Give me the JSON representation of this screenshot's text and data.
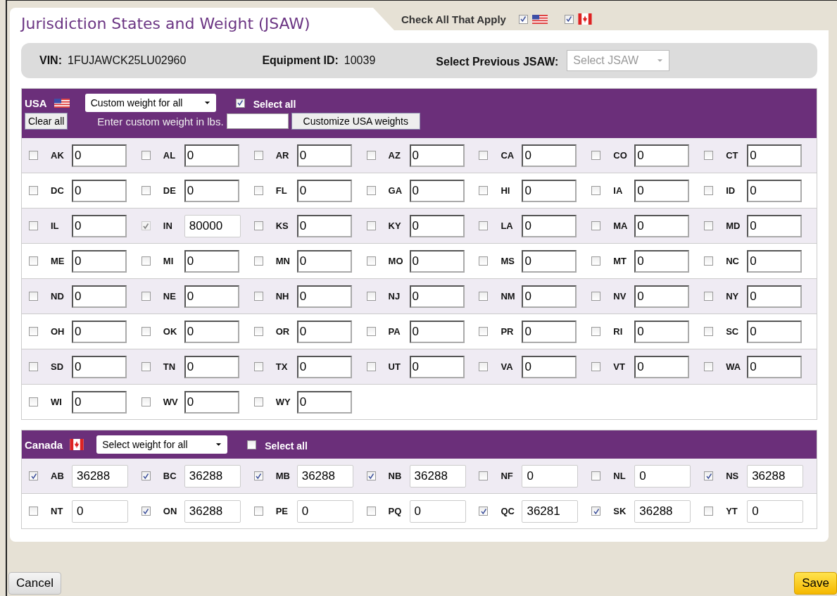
{
  "title": "Jurisdiction States and Weight (JSAW)",
  "apply": {
    "label": "Check All That Apply",
    "usa_checked": true,
    "canada_checked": true
  },
  "info": {
    "vin_label": "VIN:",
    "vin": "1FUJAWCK25LU02960",
    "equipment_label": "Equipment ID:",
    "equipment": "10039",
    "previous_label": "Select Previous JSAW:",
    "previous_placeholder": "Select JSAW"
  },
  "usa": {
    "name": "USA",
    "weight_select": "Custom weight for all",
    "select_all_label": "Select all",
    "select_all_checked": true,
    "clear_button": "Clear all",
    "custom_label": "Enter custom weight in lbs.",
    "customize_button": "Customize USA weights",
    "states": [
      {
        "code": "AK",
        "value": "0",
        "checked": false,
        "disabled": false
      },
      {
        "code": "AL",
        "value": "0",
        "checked": false,
        "disabled": false
      },
      {
        "code": "AR",
        "value": "0",
        "checked": false,
        "disabled": false
      },
      {
        "code": "AZ",
        "value": "0",
        "checked": false,
        "disabled": false
      },
      {
        "code": "CA",
        "value": "0",
        "checked": false,
        "disabled": false
      },
      {
        "code": "CO",
        "value": "0",
        "checked": false,
        "disabled": false
      },
      {
        "code": "CT",
        "value": "0",
        "checked": false,
        "disabled": false
      },
      {
        "code": "DC",
        "value": "0",
        "checked": false,
        "disabled": false
      },
      {
        "code": "DE",
        "value": "0",
        "checked": false,
        "disabled": false
      },
      {
        "code": "FL",
        "value": "0",
        "checked": false,
        "disabled": false
      },
      {
        "code": "GA",
        "value": "0",
        "checked": false,
        "disabled": false
      },
      {
        "code": "HI",
        "value": "0",
        "checked": false,
        "disabled": false
      },
      {
        "code": "IA",
        "value": "0",
        "checked": false,
        "disabled": false
      },
      {
        "code": "ID",
        "value": "0",
        "checked": false,
        "disabled": false
      },
      {
        "code": "IL",
        "value": "0",
        "checked": false,
        "disabled": false
      },
      {
        "code": "IN",
        "value": "80000",
        "checked": true,
        "disabled": true
      },
      {
        "code": "KS",
        "value": "0",
        "checked": false,
        "disabled": false
      },
      {
        "code": "KY",
        "value": "0",
        "checked": false,
        "disabled": false
      },
      {
        "code": "LA",
        "value": "0",
        "checked": false,
        "disabled": false
      },
      {
        "code": "MA",
        "value": "0",
        "checked": false,
        "disabled": false
      },
      {
        "code": "MD",
        "value": "0",
        "checked": false,
        "disabled": false
      },
      {
        "code": "ME",
        "value": "0",
        "checked": false,
        "disabled": false
      },
      {
        "code": "MI",
        "value": "0",
        "checked": false,
        "disabled": false
      },
      {
        "code": "MN",
        "value": "0",
        "checked": false,
        "disabled": false
      },
      {
        "code": "MO",
        "value": "0",
        "checked": false,
        "disabled": false
      },
      {
        "code": "MS",
        "value": "0",
        "checked": false,
        "disabled": false
      },
      {
        "code": "MT",
        "value": "0",
        "checked": false,
        "disabled": false
      },
      {
        "code": "NC",
        "value": "0",
        "checked": false,
        "disabled": false
      },
      {
        "code": "ND",
        "value": "0",
        "checked": false,
        "disabled": false
      },
      {
        "code": "NE",
        "value": "0",
        "checked": false,
        "disabled": false
      },
      {
        "code": "NH",
        "value": "0",
        "checked": false,
        "disabled": false
      },
      {
        "code": "NJ",
        "value": "0",
        "checked": false,
        "disabled": false
      },
      {
        "code": "NM",
        "value": "0",
        "checked": false,
        "disabled": false
      },
      {
        "code": "NV",
        "value": "0",
        "checked": false,
        "disabled": false
      },
      {
        "code": "NY",
        "value": "0",
        "checked": false,
        "disabled": false
      },
      {
        "code": "OH",
        "value": "0",
        "checked": false,
        "disabled": false
      },
      {
        "code": "OK",
        "value": "0",
        "checked": false,
        "disabled": false
      },
      {
        "code": "OR",
        "value": "0",
        "checked": false,
        "disabled": false
      },
      {
        "code": "PA",
        "value": "0",
        "checked": false,
        "disabled": false
      },
      {
        "code": "PR",
        "value": "0",
        "checked": false,
        "disabled": false
      },
      {
        "code": "RI",
        "value": "0",
        "checked": false,
        "disabled": false
      },
      {
        "code": "SC",
        "value": "0",
        "checked": false,
        "disabled": false
      },
      {
        "code": "SD",
        "value": "0",
        "checked": false,
        "disabled": false
      },
      {
        "code": "TN",
        "value": "0",
        "checked": false,
        "disabled": false
      },
      {
        "code": "TX",
        "value": "0",
        "checked": false,
        "disabled": false
      },
      {
        "code": "UT",
        "value": "0",
        "checked": false,
        "disabled": false
      },
      {
        "code": "VA",
        "value": "0",
        "checked": false,
        "disabled": false
      },
      {
        "code": "VT",
        "value": "0",
        "checked": false,
        "disabled": false
      },
      {
        "code": "WA",
        "value": "0",
        "checked": false,
        "disabled": false
      },
      {
        "code": "WI",
        "value": "0",
        "checked": false,
        "disabled": false
      },
      {
        "code": "WV",
        "value": "0",
        "checked": false,
        "disabled": false
      },
      {
        "code": "WY",
        "value": "0",
        "checked": false,
        "disabled": false
      }
    ]
  },
  "canada": {
    "name": "Canada",
    "weight_select": "Select weight for all",
    "select_all_label": "Select all",
    "select_all_checked": false,
    "states": [
      {
        "code": "AB",
        "value": "36288",
        "checked": true
      },
      {
        "code": "BC",
        "value": "36288",
        "checked": true
      },
      {
        "code": "MB",
        "value": "36288",
        "checked": true
      },
      {
        "code": "NB",
        "value": "36288",
        "checked": true
      },
      {
        "code": "NF",
        "value": "0",
        "checked": false
      },
      {
        "code": "NL",
        "value": "0",
        "checked": false
      },
      {
        "code": "NS",
        "value": "36288",
        "checked": true
      },
      {
        "code": "NT",
        "value": "0",
        "checked": false
      },
      {
        "code": "ON",
        "value": "36288",
        "checked": true
      },
      {
        "code": "PE",
        "value": "0",
        "checked": false
      },
      {
        "code": "PQ",
        "value": "0",
        "checked": false
      },
      {
        "code": "QC",
        "value": "36281",
        "checked": true
      },
      {
        "code": "SK",
        "value": "36288",
        "checked": true
      },
      {
        "code": "YT",
        "value": "0",
        "checked": false
      }
    ]
  },
  "buttons": {
    "cancel": "Cancel",
    "save": "Save"
  }
}
